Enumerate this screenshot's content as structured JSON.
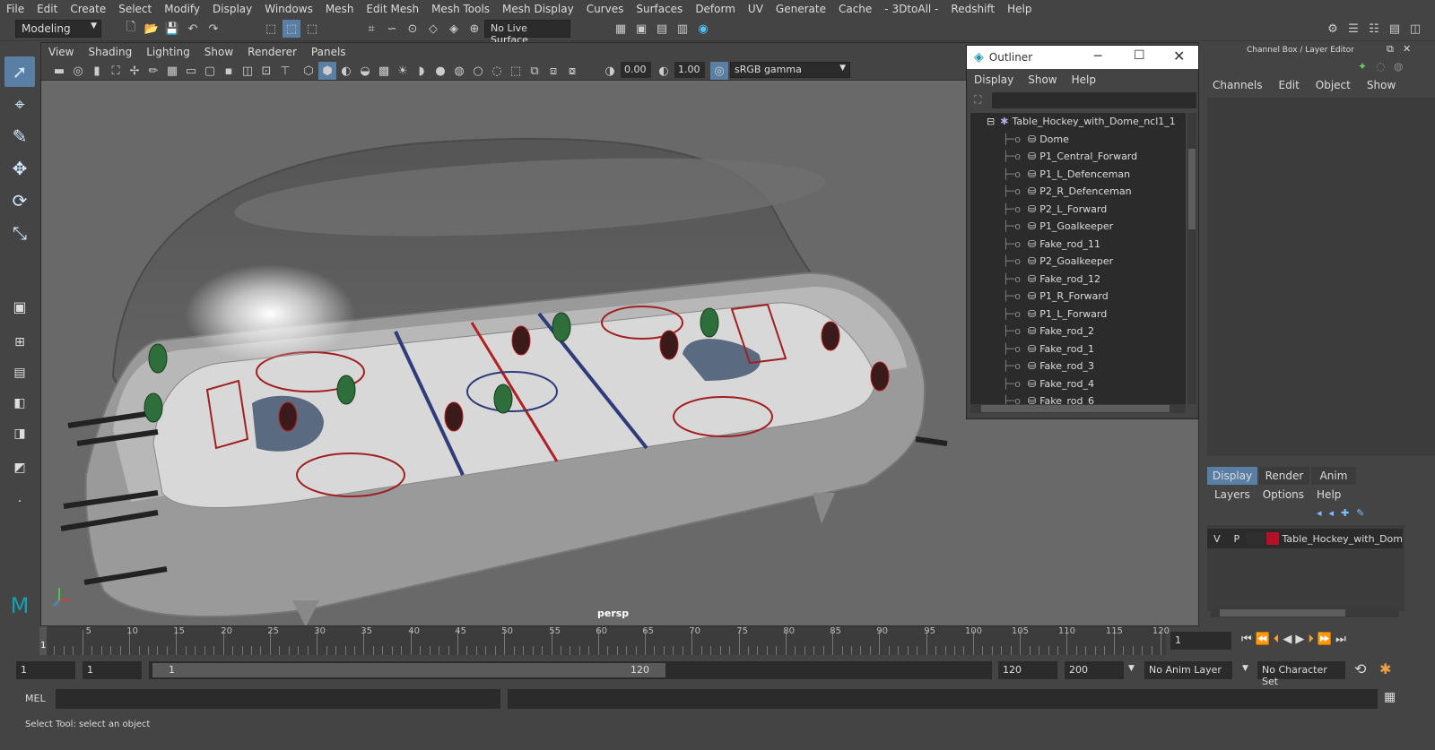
{
  "menubar": [
    "File",
    "Edit",
    "Create",
    "Select",
    "Modify",
    "Display",
    "Windows",
    "Mesh",
    "Edit Mesh",
    "Mesh Tools",
    "Mesh Display",
    "Curves",
    "Surfaces",
    "Deform",
    "UV",
    "Generate",
    "Cache",
    "- 3DtoAll -",
    "Redshift",
    "Help"
  ],
  "statusline": {
    "workspace": "Modeling",
    "live_surface": "No Live Surface"
  },
  "viewport": {
    "menu": [
      "View",
      "Shading",
      "Lighting",
      "Show",
      "Renderer",
      "Panels"
    ],
    "exposure": "0.00",
    "gamma": "1.00",
    "colorspace": "sRGB gamma",
    "camera_label": "persp"
  },
  "outliner": {
    "title": "Outliner",
    "menu": [
      "Display",
      "Show",
      "Help"
    ],
    "root": "Table_Hockey_with_Dome_ncl1_1",
    "items": [
      "Dome",
      "P1_Central_Forward",
      "P1_L_Defenceman",
      "P2_R_Defenceman",
      "P2_L_Forward",
      "P1_Goalkeeper",
      "Fake_rod_11",
      "P2_Goalkeeper",
      "Fake_rod_12",
      "P1_R_Forward",
      "P1_L_Forward",
      "Fake_rod_2",
      "Fake_rod_1",
      "Fake_rod_3",
      "Fake_rod_4",
      "Fake_rod_6"
    ]
  },
  "channelbox": {
    "title": "Channel Box / Layer Editor",
    "menu": [
      "Channels",
      "Edit",
      "Object",
      "Show"
    ]
  },
  "layereditor": {
    "tabs": [
      "Display",
      "Render",
      "Anim"
    ],
    "menu": [
      "Layers",
      "Options",
      "Help"
    ],
    "layer": {
      "v": "V",
      "p": "P",
      "name": "Table_Hockey_with_Dom",
      "color": "#b5102a"
    }
  },
  "timeline": {
    "ticks": [
      "5",
      "10",
      "15",
      "20",
      "25",
      "30",
      "35",
      "40",
      "45",
      "50",
      "55",
      "60",
      "65",
      "70",
      "75",
      "80",
      "85",
      "90",
      "95",
      "100",
      "105",
      "110",
      "115",
      "120"
    ],
    "current_frame_marker": "1",
    "current_frame_field": "1"
  },
  "range": {
    "start": "1",
    "anim_start": "1",
    "slider_start": "1",
    "slider_end": "120",
    "end": "120",
    "anim_end": "200",
    "anim_layer": "No Anim Layer",
    "character_set": "No Character Set"
  },
  "cmdline": {
    "label": "MEL"
  },
  "helpline": {
    "text": "Select Tool: select an object"
  },
  "colors": {
    "panel": "#444444",
    "field": "#2b2b2b",
    "viewport": "#696969",
    "accent": "#5a7fa4"
  }
}
